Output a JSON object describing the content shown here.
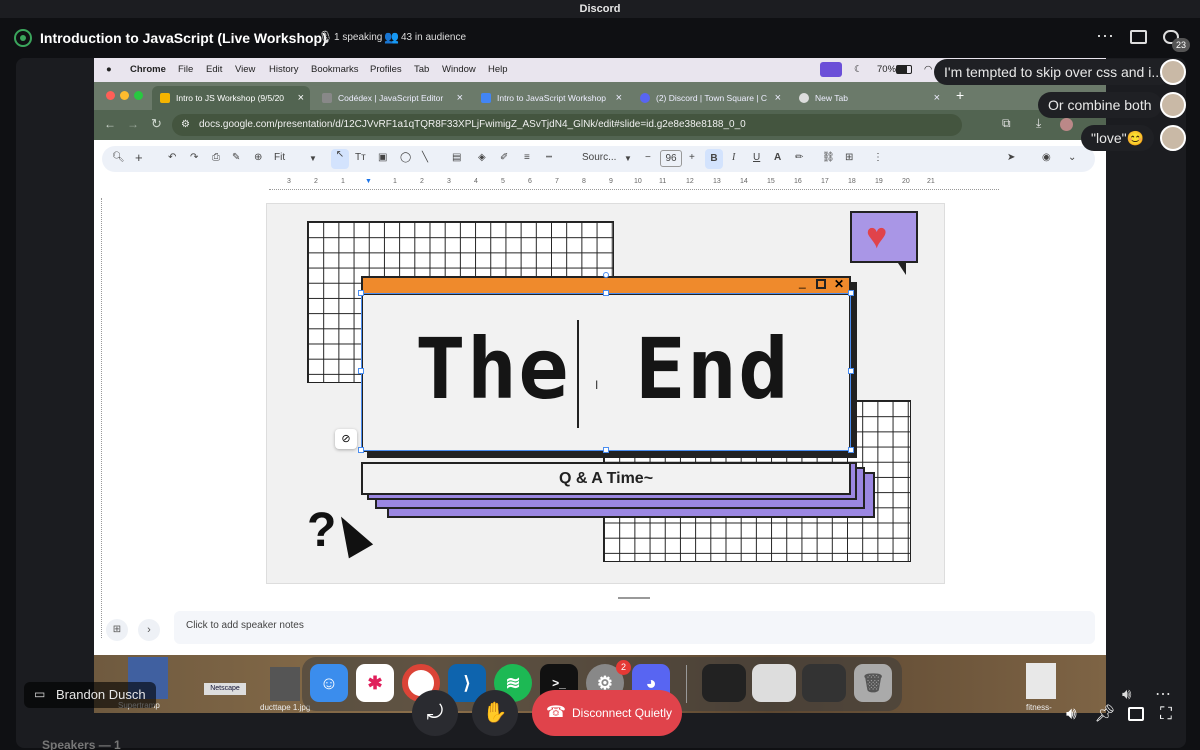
{
  "app_title": "Discord",
  "stage": {
    "name": "Introduction to JavaScript (Live Workshop)",
    "speaking": "1 speaking",
    "audience": "43 in audience",
    "badge": "23"
  },
  "chat": {
    "bubble1": "I'm tempted to skip over css and i...",
    "bubble2": "Or combine both",
    "bubble3": "\"love\"😊"
  },
  "mac_menu": {
    "app": "Chrome",
    "items": [
      "File",
      "Edit",
      "View",
      "History",
      "Bookmarks",
      "Profiles",
      "Tab",
      "Window",
      "Help"
    ],
    "battery": "70%"
  },
  "tabs": [
    {
      "label": "Intro to JS Workshop (9/5/20",
      "color": "#f4b400"
    },
    {
      "label": "Codédex | JavaScript Editor",
      "color": "#888888"
    },
    {
      "label": "Intro to JavaScript Workshop",
      "color": "#4285f4"
    },
    {
      "label": "(2) Discord | Town Square | C",
      "color": "#5865f2"
    },
    {
      "label": "New Tab",
      "color": "#dddddd"
    }
  ],
  "url": "docs.google.com/presentation/d/12CJVvRF1a1qTQR8F33XPLjFwimigZ_ASvTjdN4_GlNk/edit#slide=id.g2e8e38e8188_0_0",
  "toolbar": {
    "zoom": "Fit",
    "font": "Sourc...",
    "size": "96",
    "bold": "B",
    "italic": "I",
    "underline": "U"
  },
  "ruler": [
    "3",
    "2",
    "1",
    "1",
    "2",
    "3",
    "4",
    "5",
    "6",
    "7",
    "8",
    "9",
    "10",
    "11",
    "12",
    "13",
    "14",
    "15",
    "16",
    "17",
    "18",
    "19",
    "20",
    "21"
  ],
  "slide": {
    "title_left": "The",
    "title_right": "End",
    "subtitle": "Q & A Time~",
    "cursor": "I",
    "question": "?"
  },
  "notes": "Click to add speaker notes",
  "dock": {
    "badge": "2",
    "labels": [
      "Supertramp",
      "Netscape",
      "ducttape 1.jpg",
      "fitness-"
    ]
  },
  "bottom": {
    "speaker": "Brandon Dusch",
    "disconnect": "Disconnect Quietly",
    "speakers_count": "Speakers — 1"
  },
  "colors": {
    "orange": "#ef8a2c",
    "purple": "#9b87e2",
    "red": "#e0434b",
    "discord_bg": "#0f1013"
  }
}
